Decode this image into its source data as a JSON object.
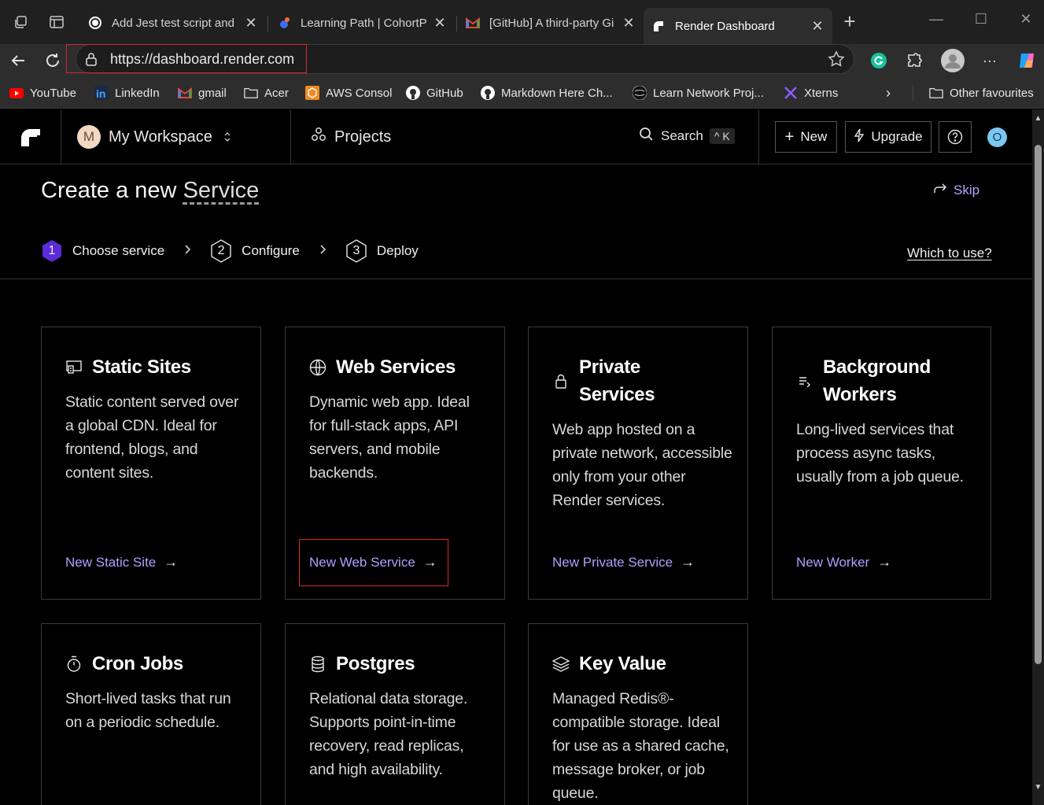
{
  "browser": {
    "tabs": [
      {
        "label": "Add Jest test script and e",
        "icon": "github-copilot-icon"
      },
      {
        "label": "Learning Path | CohortPr",
        "icon": "cohort-icon"
      },
      {
        "label": "[GitHub] A third-party Gi",
        "icon": "gmail-icon"
      },
      {
        "label": "Render Dashboard",
        "icon": "render-icon"
      }
    ],
    "url": "https://dashboard.render.com",
    "bookmarks": [
      {
        "label": "YouTube",
        "icon": "youtube-icon"
      },
      {
        "label": "LinkedIn",
        "icon": "linkedin-icon"
      },
      {
        "label": "gmail",
        "icon": "gmail-icon"
      },
      {
        "label": "Acer",
        "icon": "folder-icon"
      },
      {
        "label": "AWS Consol",
        "icon": "aws-icon"
      },
      {
        "label": "GitHub",
        "icon": "github-icon"
      },
      {
        "label": "Markdown Here Ch...",
        "icon": "github-icon"
      },
      {
        "label": "Learn Network Proj...",
        "icon": "network-icon"
      },
      {
        "label": "Xterns",
        "icon": "xterns-icon"
      }
    ],
    "other_favourites": "Other favourites"
  },
  "header": {
    "workspace_initial": "M",
    "workspace_name": "My Workspace",
    "projects": "Projects",
    "search": "Search",
    "search_shortcut": "^ K",
    "new_button": "New",
    "upgrade_button": "Upgrade",
    "help_button": "?",
    "user_initial": "O"
  },
  "page": {
    "title_prefix": "Create a new",
    "title_word": "Service",
    "skip": "Skip",
    "which_to_use": "Which to use?",
    "steps": [
      {
        "num": "1",
        "label": "Choose service",
        "active": true
      },
      {
        "num": "2",
        "label": "Configure",
        "active": false
      },
      {
        "num": "3",
        "label": "Deploy",
        "active": false
      }
    ]
  },
  "cards": [
    {
      "title": "Static Sites",
      "desc": "Static content served over a global CDN. Ideal for frontend, blogs, and content sites.",
      "link": "New Static Site",
      "icon": "static-site-icon"
    },
    {
      "title": "Web Services",
      "desc": "Dynamic web app. Ideal for full-stack apps, API servers, and mobile backends.",
      "link": "New Web Service",
      "icon": "globe-icon"
    },
    {
      "title": "Private Services",
      "desc": "Web app hosted on a private network, accessible only from your other Render services.",
      "link": "New Private Service",
      "icon": "lock-icon"
    },
    {
      "title": "Background Workers",
      "desc": "Long-lived services that process async tasks, usually from a job queue.",
      "link": "New Worker",
      "icon": "worker-icon"
    },
    {
      "title": "Cron Jobs",
      "desc": "Short-lived tasks that run on a periodic schedule.",
      "link": "",
      "icon": "timer-icon"
    },
    {
      "title": "Postgres",
      "desc": "Relational data storage. Supports point-in-time recovery, read replicas, and high availability.",
      "link": "",
      "icon": "database-icon"
    },
    {
      "title": "Key Value",
      "desc": "Managed Redis®-compatible storage. Ideal for use as a shared cache, message broker, or job queue.",
      "link": "",
      "icon": "layers-icon"
    }
  ]
}
